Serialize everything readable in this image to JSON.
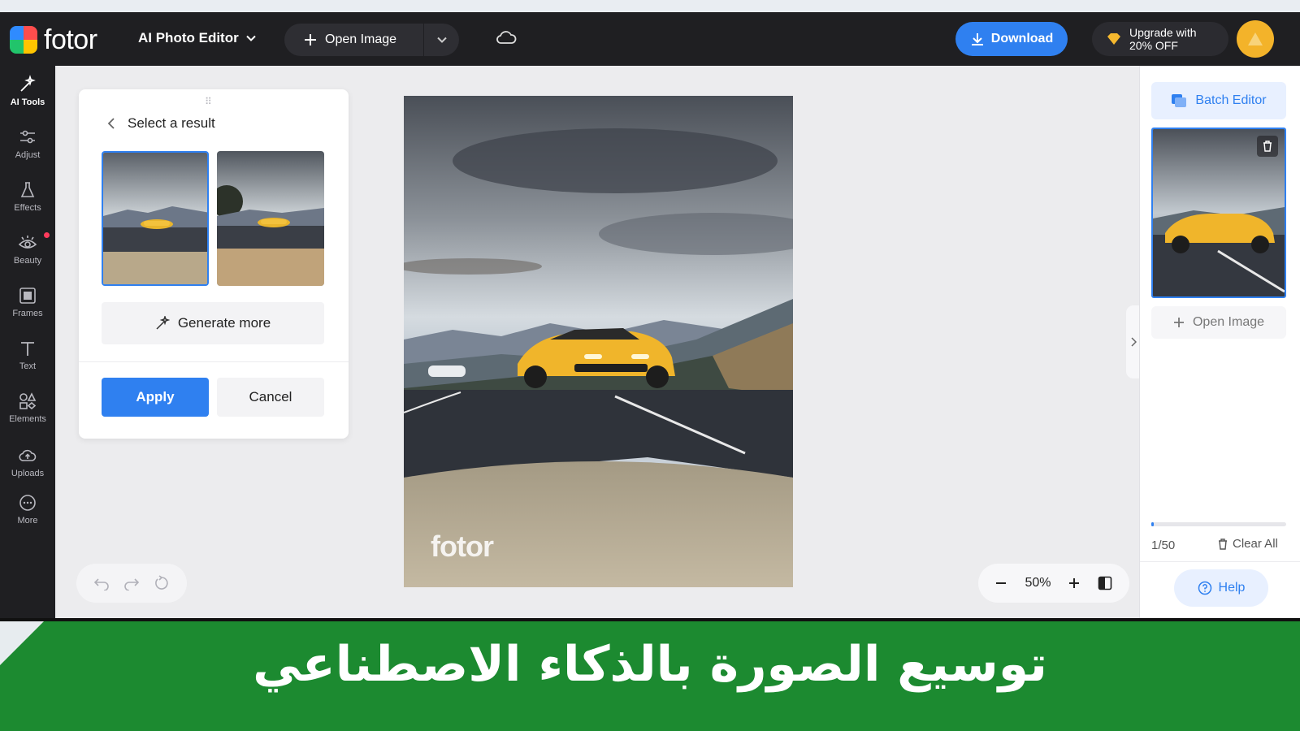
{
  "header": {
    "brand": "fotor",
    "editor_mode": "AI Photo Editor",
    "open_image_label": "Open Image",
    "download_label": "Download",
    "upgrade_line1": "Upgrade with",
    "upgrade_line2": "20% OFF",
    "accent_color": "#2f80f0"
  },
  "sidebar": {
    "items": [
      {
        "label": "AI Tools",
        "icon": "ai-tools-icon",
        "active": true
      },
      {
        "label": "Adjust",
        "icon": "sliders-icon"
      },
      {
        "label": "Effects",
        "icon": "flask-icon"
      },
      {
        "label": "Beauty",
        "icon": "eye-icon"
      },
      {
        "label": "Frames",
        "icon": "frame-icon"
      },
      {
        "label": "Text",
        "icon": "text-icon"
      },
      {
        "label": "Elements",
        "icon": "shapes-icon"
      },
      {
        "label": "Uploads",
        "icon": "upload-cloud-icon"
      },
      {
        "label": "More",
        "icon": "more-icon"
      }
    ]
  },
  "result_panel": {
    "title": "Select a result",
    "generate_more_label": "Generate more",
    "apply_label": "Apply",
    "cancel_label": "Cancel"
  },
  "canvas": {
    "watermark": "fotor"
  },
  "zoom": {
    "level": "50%"
  },
  "right_panel": {
    "batch_editor_label": "Batch Editor",
    "open_image_label": "Open Image",
    "count": "1/50",
    "progress_fraction": 0.02,
    "clear_all_label": "Clear All",
    "help_label": "Help"
  },
  "banner": {
    "text": "توسيع الصورة بالذكاء الاصطناعي",
    "color": "#1c8a30"
  }
}
